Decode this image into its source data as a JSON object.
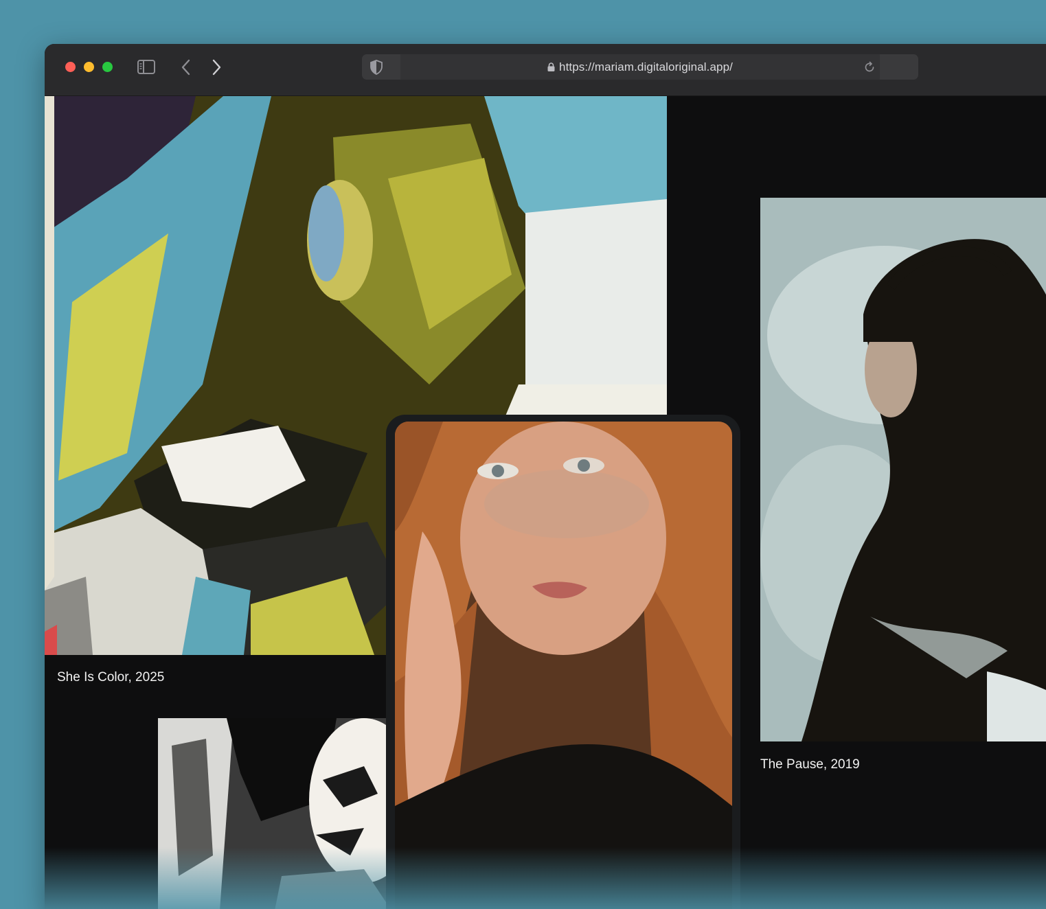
{
  "browser": {
    "url": "https://mariam.digitaloriginal.app/"
  },
  "gallery": {
    "artworks": [
      {
        "caption": "She Is Color, 2025"
      },
      {
        "caption": "The Pause, 2019"
      }
    ]
  },
  "colors": {
    "background": "#4e93a8",
    "window": "#0e0e0f",
    "chrome": "#2a2a2c"
  }
}
